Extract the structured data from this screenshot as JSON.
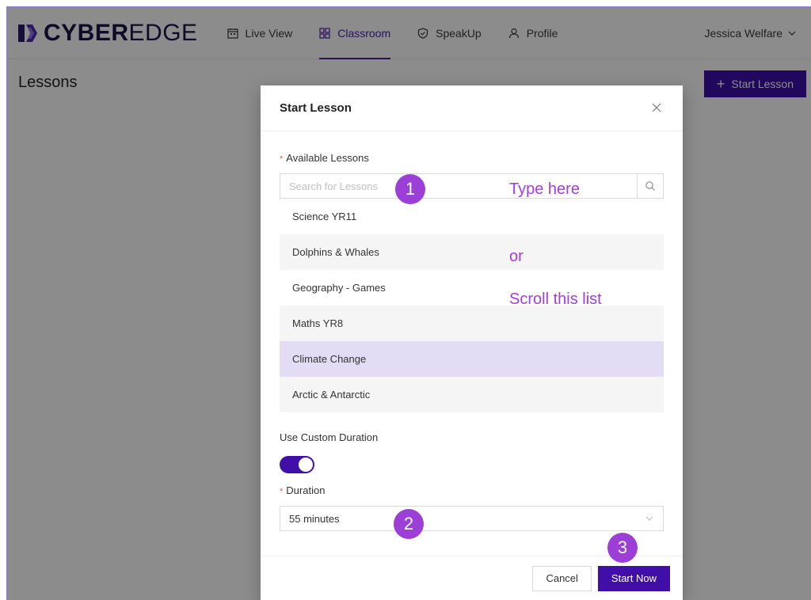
{
  "brand": {
    "bold": "CYBER",
    "light": "EDGE"
  },
  "nav": {
    "items": [
      {
        "label": "Live View",
        "icon": "calendar-icon",
        "active": false
      },
      {
        "label": "Classroom",
        "icon": "grid-icon",
        "active": true
      },
      {
        "label": "SpeakUp",
        "icon": "shield-icon",
        "active": false
      },
      {
        "label": "Profile",
        "icon": "user-icon",
        "active": false
      }
    ],
    "user": "Jessica Welfare"
  },
  "page": {
    "title": "Lessons",
    "start_lesson_label": "Start Lesson"
  },
  "modal": {
    "title": "Start Lesson",
    "available_lessons_label": "Available Lessons",
    "search_placeholder": "Search for Lessons",
    "lessons": [
      {
        "label": "Science YR11",
        "state": "normal"
      },
      {
        "label": "Dolphins & Whales",
        "state": "alt"
      },
      {
        "label": "Geography - Games",
        "state": "normal"
      },
      {
        "label": "Maths YR8",
        "state": "alt"
      },
      {
        "label": "Climate Change",
        "state": "selected"
      },
      {
        "label": "Arctic & Antarctic",
        "state": "alt"
      }
    ],
    "custom_duration_label": "Use Custom Duration",
    "custom_duration_on": true,
    "duration_label": "Duration",
    "duration_value": "55 minutes",
    "cancel_label": "Cancel",
    "start_now_label": "Start Now"
  },
  "annotations": {
    "badge_1": "1",
    "badge_2": "2",
    "badge_3": "3",
    "type_here": "Type here",
    "or": "or",
    "scroll_list": "Scroll this list"
  },
  "colors": {
    "accent": "#3f0fa8",
    "annotation": "#9b3fd6",
    "selected_row": "#e3dcf5"
  }
}
